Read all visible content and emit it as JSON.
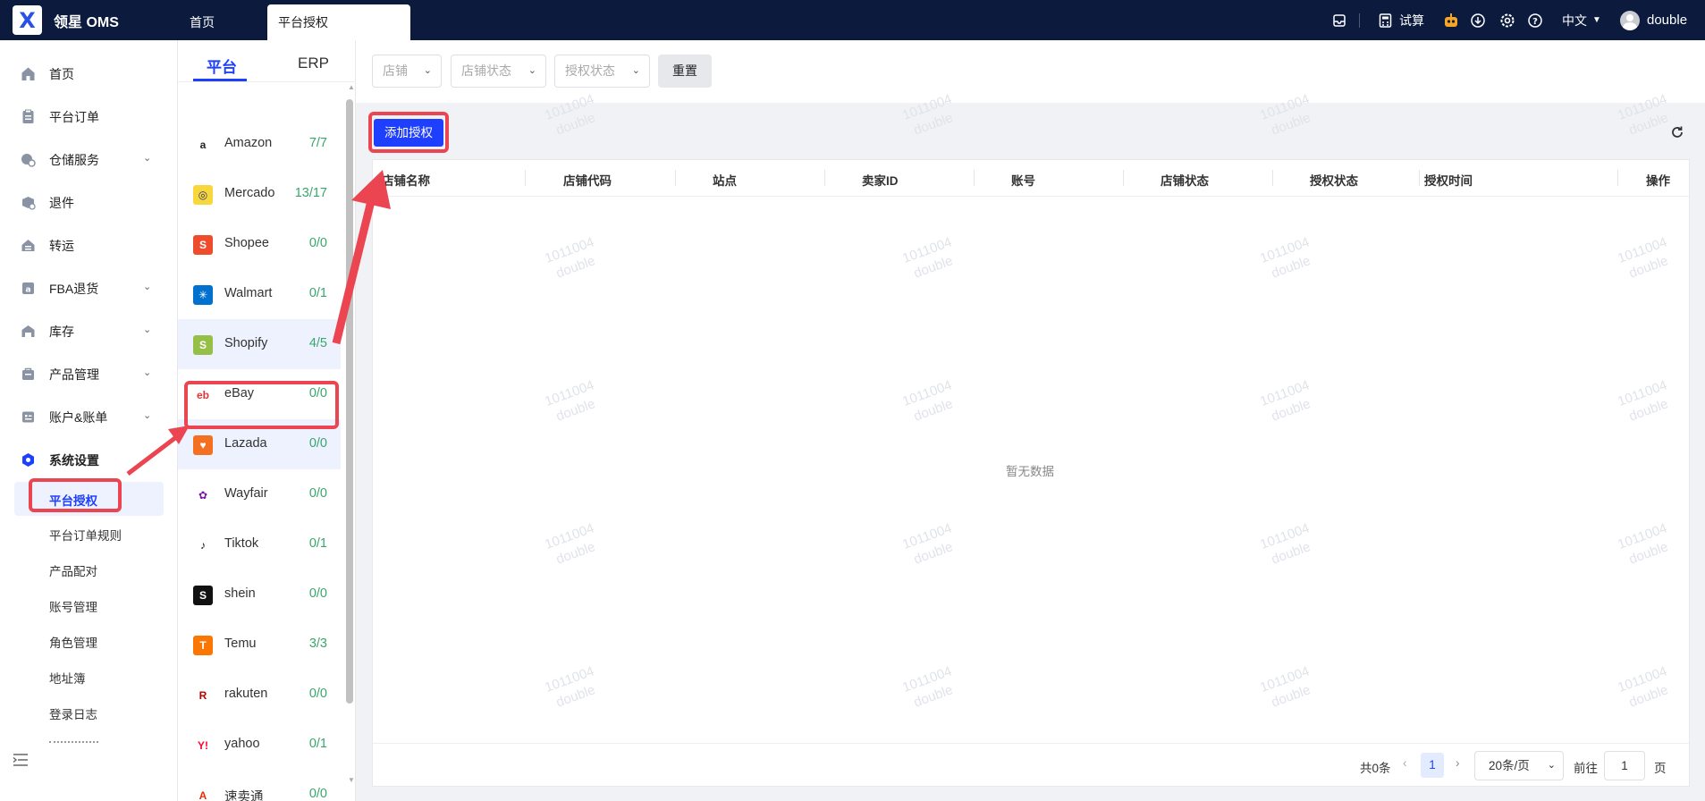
{
  "topbar": {
    "logo": "X",
    "app_title": "领星 OMS",
    "tabs": [
      {
        "label": "首页"
      },
      {
        "label": "平台授权"
      }
    ],
    "trial_label": "试算",
    "language": "中文",
    "username": "double"
  },
  "sidebar": {
    "items": [
      {
        "label": "首页",
        "icon": "home-icon"
      },
      {
        "label": "平台订单",
        "icon": "clipboard-icon"
      },
      {
        "label": "仓储服务",
        "icon": "warehouse-icon"
      },
      {
        "label": "退件",
        "icon": "return-box-icon"
      },
      {
        "label": "转运",
        "icon": "transfer-icon"
      },
      {
        "label": "FBA退货",
        "icon": "fba-return-icon"
      },
      {
        "label": "库存",
        "icon": "inventory-icon"
      },
      {
        "label": "产品管理",
        "icon": "product-icon"
      },
      {
        "label": "账户&账单",
        "icon": "account-icon"
      },
      {
        "label": "系统设置",
        "icon": "settings-hex-icon"
      }
    ],
    "sub_items": [
      {
        "label": "平台授权"
      },
      {
        "label": "平台订单规则"
      },
      {
        "label": "产品配对"
      },
      {
        "label": "账号管理"
      },
      {
        "label": "角色管理"
      },
      {
        "label": "地址簿"
      },
      {
        "label": "登录日志"
      }
    ]
  },
  "platform_panel": {
    "tabs": [
      {
        "label": "平台"
      },
      {
        "label": "ERP"
      }
    ],
    "platforms": [
      {
        "name": "Amazon",
        "count": "7/7",
        "icon": "amazon-icon",
        "color": "#222222"
      },
      {
        "name": "Mercado",
        "count": "13/17",
        "icon": "mercado-icon",
        "color": "#f7d83c"
      },
      {
        "name": "Shopee",
        "count": "0/0",
        "icon": "shopee-icon",
        "color": "#ee4d2d"
      },
      {
        "name": "Walmart",
        "count": "0/1",
        "icon": "walmart-icon",
        "color": "#0071ce"
      },
      {
        "name": "Shopify",
        "count": "4/5",
        "icon": "shopify-icon",
        "color": "#95bf47"
      },
      {
        "name": "eBay",
        "count": "0/0",
        "icon": "ebay-icon",
        "color": "#e53238"
      },
      {
        "name": "Lazada",
        "count": "0/0",
        "icon": "lazada-icon",
        "color": "#f36f21"
      },
      {
        "name": "Wayfair",
        "count": "0/0",
        "icon": "wayfair-icon",
        "color": "#7b189f"
      },
      {
        "name": "Tiktok",
        "count": "0/1",
        "icon": "tiktok-icon",
        "color": "#111111"
      },
      {
        "name": "shein",
        "count": "0/0",
        "icon": "shein-icon",
        "color": "#111111"
      },
      {
        "name": "Temu",
        "count": "3/3",
        "icon": "temu-icon",
        "color": "#fb7701"
      },
      {
        "name": "rakuten",
        "count": "0/0",
        "icon": "rakuten-icon",
        "color": "#bf0000"
      },
      {
        "name": "yahoo",
        "count": "0/1",
        "icon": "yahoo-icon",
        "color": "#ff0033"
      },
      {
        "name": "速卖通",
        "count": "0/0",
        "icon": "aliexpress-icon",
        "color": "#e62e04"
      }
    ]
  },
  "filters": {
    "store_placeholder": "店铺",
    "store_status_placeholder": "店铺状态",
    "auth_status_placeholder": "授权状态",
    "reset_label": "重置"
  },
  "actions": {
    "add_auth_label": "添加授权"
  },
  "table": {
    "columns": [
      "店铺名称",
      "店铺代码",
      "站点",
      "卖家ID",
      "账号",
      "店铺状态",
      "授权状态",
      "授权时间",
      "操作"
    ],
    "empty_text": "暂无数据"
  },
  "pagination": {
    "total": "共0条",
    "current_page": "1",
    "page_size": "20条/页",
    "goto_label": "前往",
    "goto_value": "1",
    "page_unit": "页"
  },
  "watermark": {
    "line1": "1011004",
    "line2": "double"
  }
}
